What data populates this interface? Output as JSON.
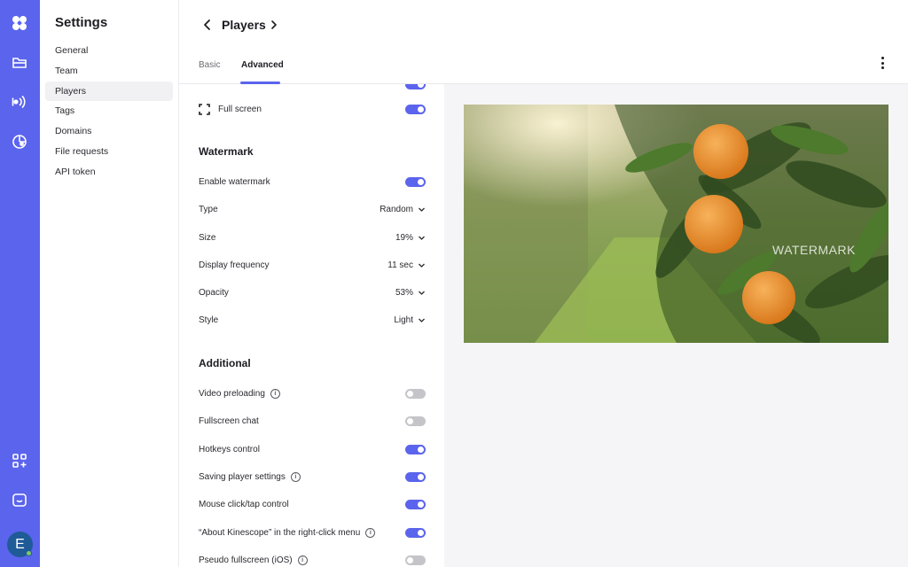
{
  "sidebar": {
    "title": "Settings",
    "items": [
      {
        "label": "General"
      },
      {
        "label": "Team"
      },
      {
        "label": "Players"
      },
      {
        "label": "Tags"
      },
      {
        "label": "Domains"
      },
      {
        "label": "File requests"
      },
      {
        "label": "API token"
      }
    ],
    "active": "Players"
  },
  "rail": {
    "icons": [
      "logo-icon",
      "folder-icon",
      "broadcast-icon",
      "analytics-icon",
      "apps-icon",
      "chat-icon"
    ],
    "avatar_letter": "E"
  },
  "header": {
    "title": "Players",
    "tabs": [
      {
        "label": "Basic"
      },
      {
        "label": "Advanced"
      }
    ],
    "active_tab": "Advanced"
  },
  "player": {
    "full_screen": {
      "label": "Full screen",
      "on": true
    }
  },
  "watermark": {
    "heading": "Watermark",
    "enable": {
      "label": "Enable watermark",
      "on": true
    },
    "type": {
      "label": "Type",
      "value": "Random"
    },
    "size": {
      "label": "Size",
      "value": "19%"
    },
    "frequency": {
      "label": "Display frequency",
      "value": "11 sec"
    },
    "opacity": {
      "label": "Opacity",
      "value": "53%"
    },
    "style": {
      "label": "Style",
      "value": "Light"
    }
  },
  "additional": {
    "heading": "Additional",
    "items": [
      {
        "label": "Video preloading",
        "info": true,
        "on": false
      },
      {
        "label": "Fullscreen chat",
        "info": false,
        "on": false
      },
      {
        "label": "Hotkeys control",
        "info": false,
        "on": true
      },
      {
        "label": "Saving player settings",
        "info": true,
        "on": true
      },
      {
        "label": "Mouse click/tap control",
        "info": false,
        "on": true
      },
      {
        "label": "“About Kinescope” in the right-click menu",
        "info": true,
        "on": true
      },
      {
        "label": "Pseudo fullscreen (iOS)",
        "info": true,
        "on": false
      }
    ]
  },
  "preview": {
    "watermark_text": "WATERMARK"
  },
  "colors": {
    "accent": "#5b64ec",
    "toggle_off": "#c4c4c9"
  }
}
